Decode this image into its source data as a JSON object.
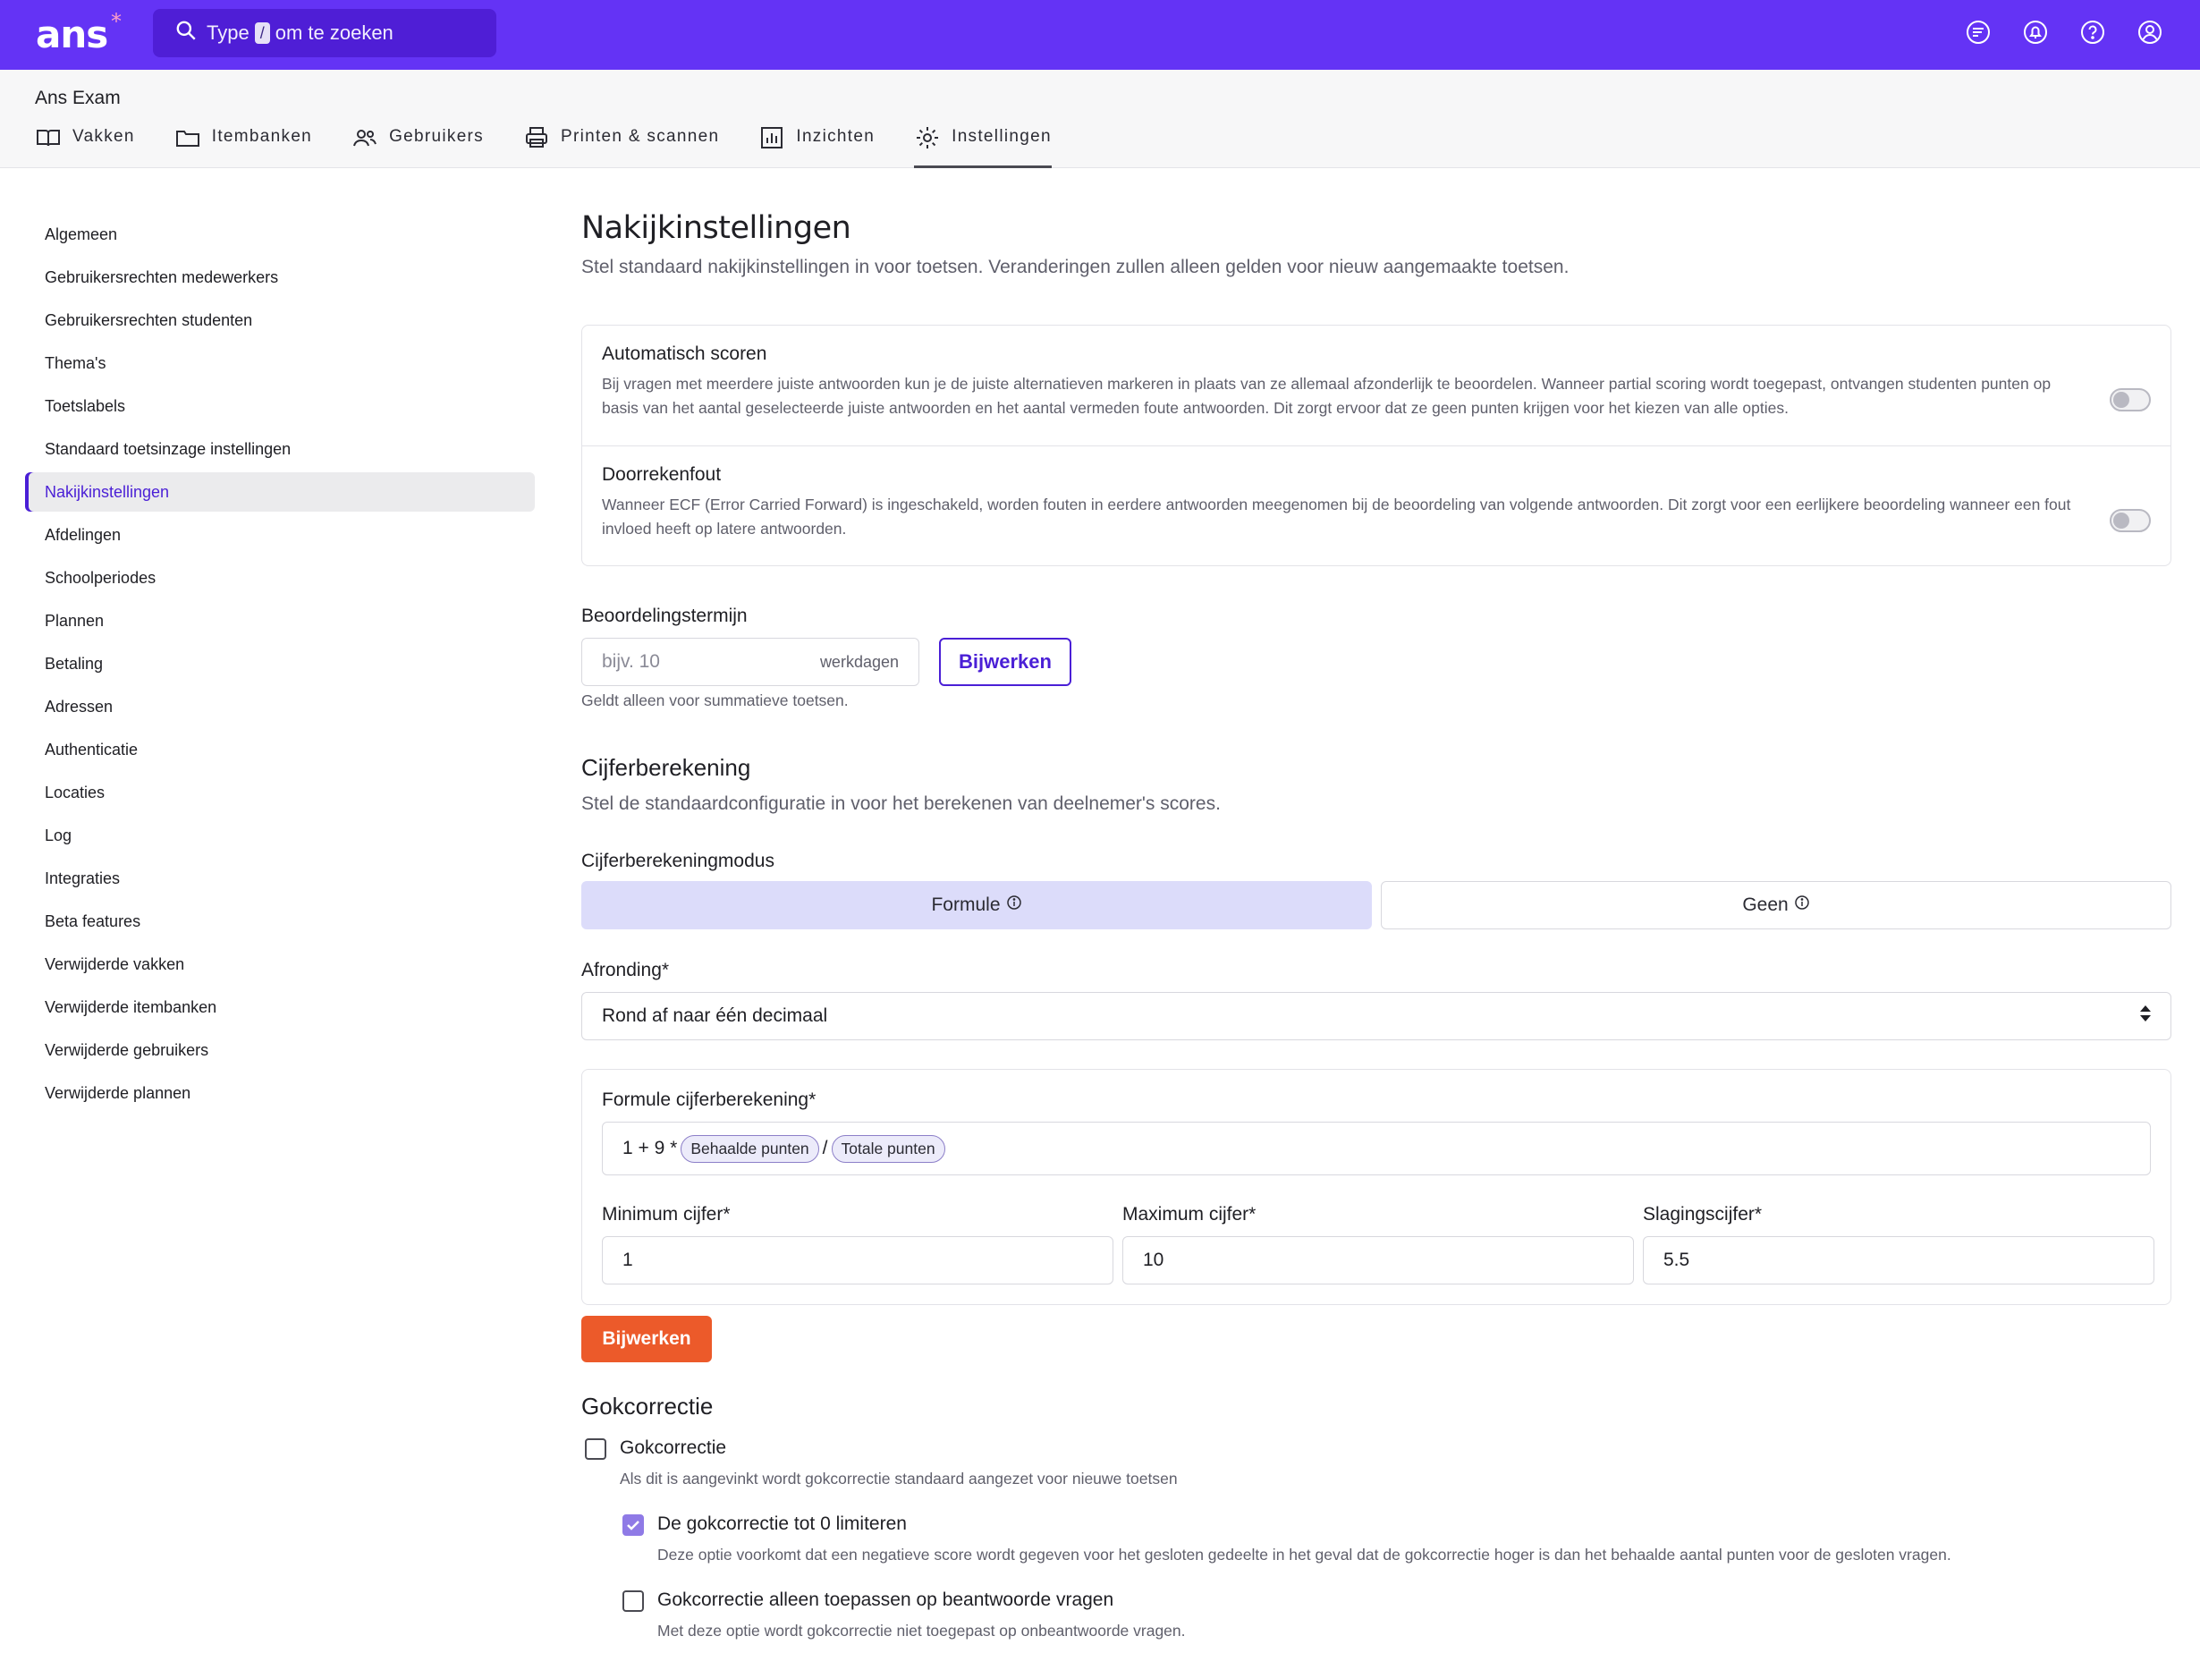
{
  "topbar": {
    "logo": "ans",
    "logo_mark": "*",
    "search_pre": "Type",
    "search_key": "/",
    "search_post": "om te zoeken",
    "icons": [
      "chat-icon",
      "bell-icon",
      "help-icon",
      "user-icon"
    ]
  },
  "app": {
    "title": "Ans Exam",
    "tabs": [
      {
        "label": "Vakken",
        "icon": "book-icon"
      },
      {
        "label": "Itembanken",
        "icon": "folder-icon"
      },
      {
        "label": "Gebruikers",
        "icon": "users-icon"
      },
      {
        "label": "Printen & scannen",
        "icon": "printer-icon"
      },
      {
        "label": "Inzichten",
        "icon": "chart-icon"
      },
      {
        "label": "Instellingen",
        "icon": "gear-icon",
        "active": true
      }
    ]
  },
  "sidebar": {
    "items": [
      "Algemeen",
      "Gebruikersrechten medewerkers",
      "Gebruikersrechten studenten",
      "Thema's",
      "Toetslabels",
      "Standaard toetsinzage instellingen",
      "Nakijkinstellingen",
      "Afdelingen",
      "Schoolperiodes",
      "Plannen",
      "Betaling",
      "Adressen",
      "Authenticatie",
      "Locaties",
      "Log",
      "Integraties",
      "Beta features",
      "Verwijderde vakken",
      "Verwijderde itembanken",
      "Verwijderde gebruikers",
      "Verwijderde plannen"
    ],
    "active_index": 6
  },
  "main": {
    "title": "Nakijkinstellingen",
    "subtitle": "Stel standaard nakijkinstellingen in voor toetsen. Veranderingen zullen alleen gelden voor nieuw aangemaakte toetsen.",
    "auto_score": {
      "title": "Automatisch scoren",
      "desc": "Bij vragen met meerdere juiste antwoorden kun je de juiste alternatieven markeren in plaats van ze allemaal afzonderlijk te beoordelen. Wanneer partial scoring wordt toegepast, ontvangen studenten punten op basis van het aantal geselecteerde juiste antwoorden en het aantal vermeden foute antwoorden. Dit zorgt ervoor dat ze geen punten krijgen voor het kiezen van alle opties.",
      "enabled": false
    },
    "ecf": {
      "title": "Doorrekenfout",
      "desc": "Wanneer ECF (Error Carried Forward) is ingeschakeld, worden fouten in eerdere antwoorden meegenomen bij de beoordeling van volgende antwoorden. Dit zorgt voor een eerlijkere beoordeling wanneer een fout invloed heeft op latere antwoorden.",
      "enabled": false
    },
    "term": {
      "label": "Beoordelingstermijn",
      "placeholder": "bijv. 10",
      "suffix": "werkdagen",
      "button": "Bijwerken",
      "hint": "Geldt alleen voor summatieve toetsen."
    },
    "grade": {
      "title": "Cijferberekening",
      "subtitle": "Stel de standaardconfiguratie in voor het berekenen van deelnemer's scores.",
      "mode_label": "Cijferberekeningmodus",
      "mode_formula": "Formule",
      "mode_none": "Geen",
      "rounding_label": "Afronding*",
      "rounding_value": "Rond af naar één decimaal",
      "formula_label": "Formule cijferberekening*",
      "formula_prefix": "1 + 9 *",
      "formula_chip1": "Behaalde punten",
      "formula_sep": "/",
      "formula_chip2": "Totale punten",
      "min_label": "Minimum cijfer*",
      "min_value": "1",
      "max_label": "Maximum cijfer*",
      "max_value": "10",
      "pass_label": "Slagingscijfer*",
      "pass_value": "5.5",
      "button": "Bijwerken"
    },
    "guess": {
      "title": "Gokcorrectie",
      "cb1_label": "Gokcorrectie",
      "cb1_hint": "Als dit is aangevinkt wordt gokcorrectie standaard aangezet voor nieuwe toetsen",
      "cb1_checked": false,
      "cb2_label": "De gokcorrectie tot 0 limiteren",
      "cb2_hint": "Deze optie voorkomt dat een negatieve score wordt gegeven voor het gesloten gedeelte in het geval dat de gokcorrectie hoger is dan het behaalde aantal punten voor de gesloten vragen.",
      "cb2_checked": true,
      "cb3_label": "Gokcorrectie alleen toepassen op beantwoorde vragen",
      "cb3_hint": "Met deze optie wordt gokcorrectie niet toegepast op onbeantwoorde vragen.",
      "cb3_checked": false
    }
  },
  "colors": {
    "brand": "#6433f5",
    "accent": "#4a1fd6",
    "cta": "#ec5a2a",
    "selected_segment": "#dcdcfa"
  }
}
